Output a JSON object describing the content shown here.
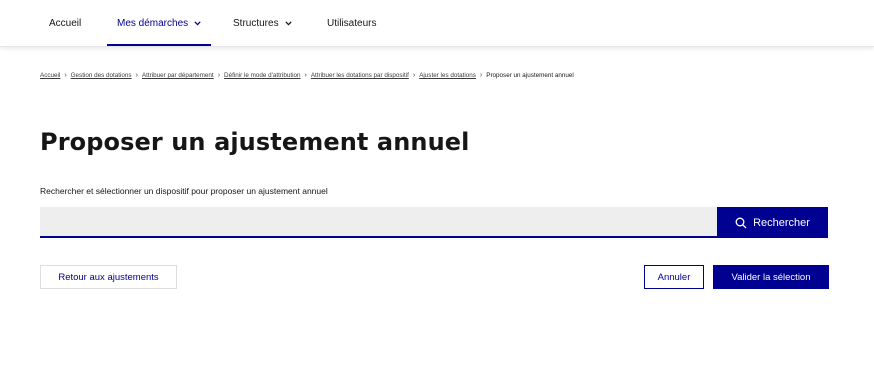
{
  "nav": {
    "items": [
      {
        "label": "Accueil",
        "has_dropdown": false,
        "active": false
      },
      {
        "label": "Mes démarches",
        "has_dropdown": true,
        "active": true
      },
      {
        "label": "Structures",
        "has_dropdown": true,
        "active": false
      },
      {
        "label": "Utilisateurs",
        "has_dropdown": false,
        "active": false
      }
    ],
    "chevron_icon": "chevron-down-icon",
    "accent_color": "#000091"
  },
  "breadcrumb": {
    "items": [
      "Accueil",
      "Gestion des dotations",
      "Attribuer par département",
      "Définir le mode d'attribution",
      "Attribuer les dotations par dispositif",
      "Ajuster les dotations"
    ],
    "current": "Proposer un ajustement annuel",
    "separator_icon": "chevron-right-icon"
  },
  "page": {
    "title": "Proposer un ajustement annuel",
    "description": "Rechercher et sélectionner un dispositif pour proposer un ajustement annuel"
  },
  "search": {
    "value": "",
    "placeholder": "",
    "button_label": "Rechercher",
    "button_icon": "search-icon"
  },
  "actions": {
    "back_label": "Retour aux ajustements",
    "cancel_label": "Annuler",
    "confirm_label": "Valider la sélection"
  },
  "colors": {
    "primary": "#000091",
    "input_bg": "#eeeeee",
    "text": "#161616"
  }
}
